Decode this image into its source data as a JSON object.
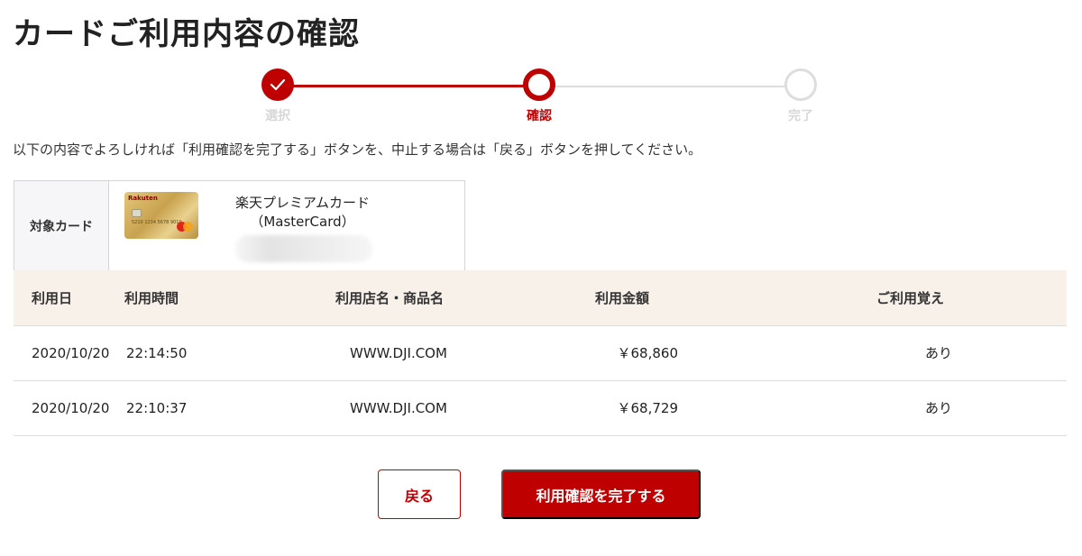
{
  "page": {
    "title": "カードご利用内容の確認",
    "instruction": "以下の内容でよろしければ「利用確認を完了する」ボタンを、中止する場合は「戻る」ボタンを押してください。"
  },
  "stepper": {
    "steps": [
      {
        "label": "選択",
        "status": "completed"
      },
      {
        "label": "確認",
        "status": "current"
      },
      {
        "label": "完了",
        "status": "pending"
      }
    ]
  },
  "card": {
    "label": "対象カード",
    "name_line1": "楽天プレミアムカード",
    "name_line2": "（MasterCard）",
    "image_brand": "Rakuten",
    "image_number": "5210 1234 5678 9010"
  },
  "table": {
    "headers": {
      "date": "利用日",
      "time": "利用時間",
      "shop": "利用店名・商品名",
      "amount": "利用金額",
      "memo": "ご利用覚え"
    },
    "rows": [
      {
        "date": "2020/10/20",
        "time": "22:14:50",
        "shop": "WWW.DJI.COM",
        "amount": "￥68,860",
        "memo": "あり"
      },
      {
        "date": "2020/10/20",
        "time": "22:10:37",
        "shop": "WWW.DJI.COM",
        "amount": "￥68,729",
        "memo": "あり"
      }
    ]
  },
  "buttons": {
    "back": "戻る",
    "confirm": "利用確認を完了する"
  },
  "colors": {
    "accent": "#bf0000",
    "header_bg": "#f8f1ea",
    "inactive": "#dddddd"
  }
}
